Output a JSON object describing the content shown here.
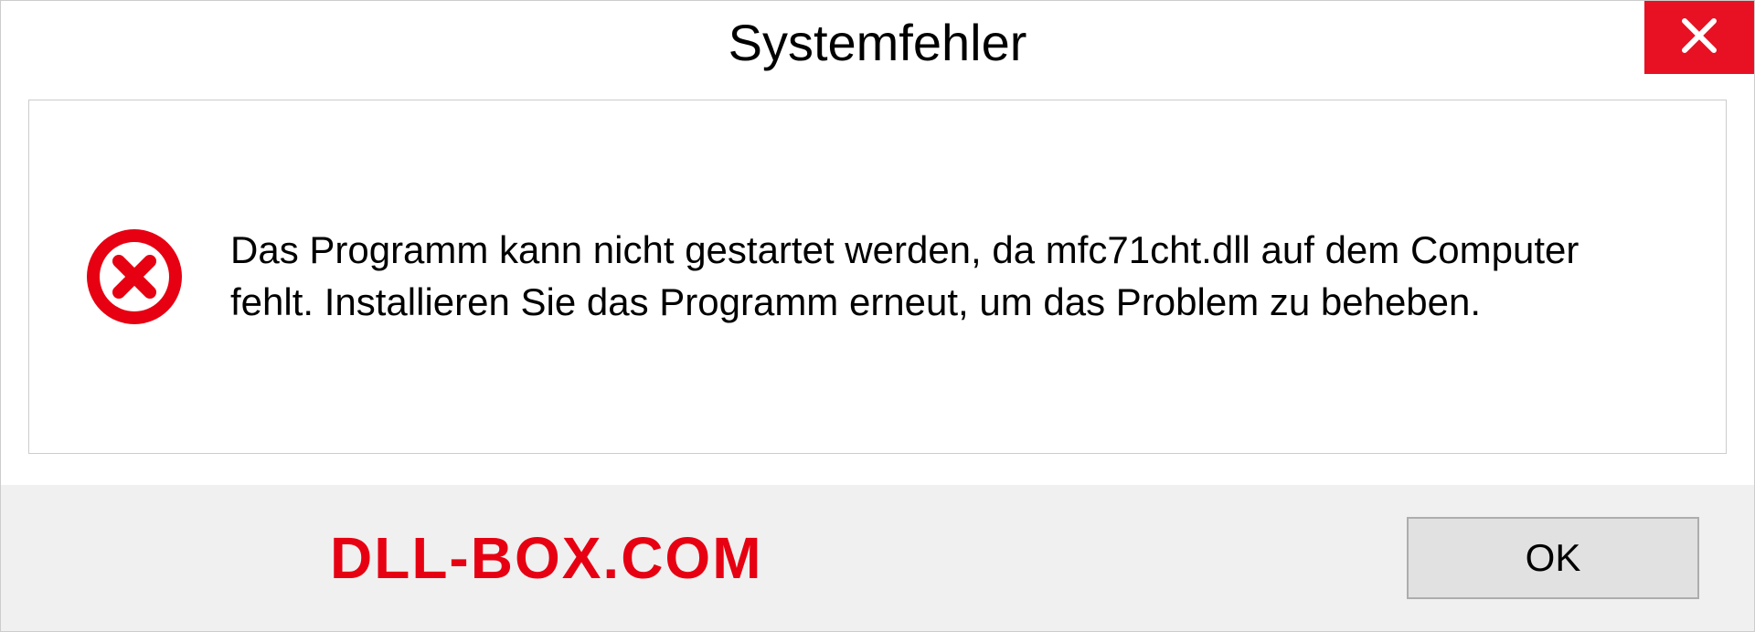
{
  "dialog": {
    "title": "Systemfehler",
    "message": "Das Programm kann nicht gestartet werden, da mfc71cht.dll auf dem Computer fehlt. Installieren Sie das Programm erneut, um das Problem zu beheben.",
    "ok_label": "OK"
  },
  "watermark": "DLL-BOX.COM"
}
